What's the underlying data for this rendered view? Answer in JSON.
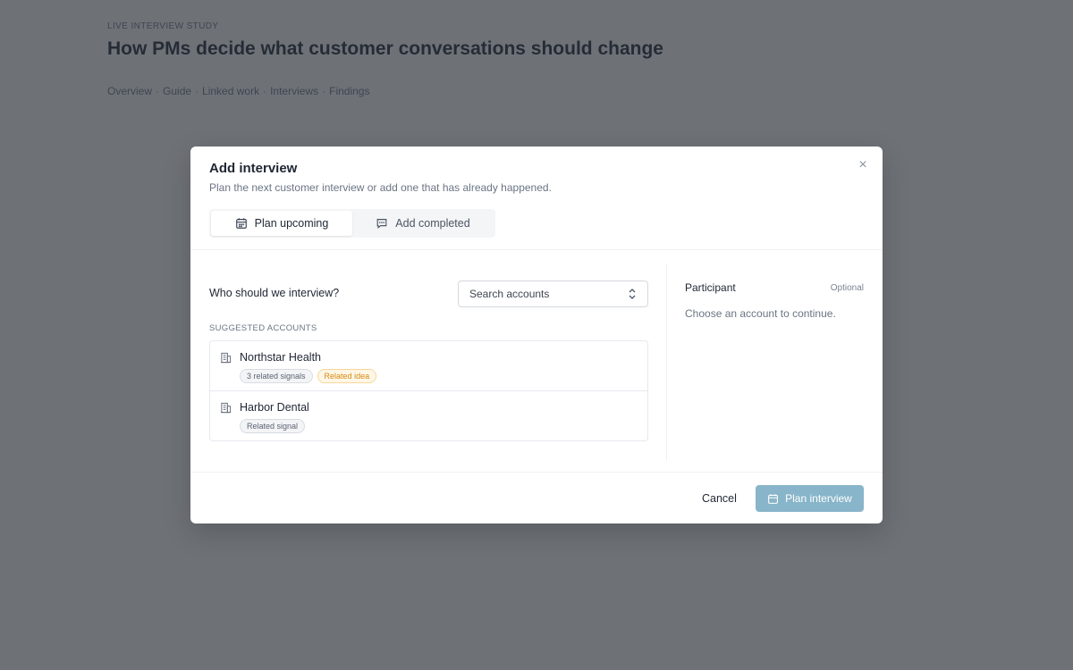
{
  "background": {
    "eyebrow": "LIVE INTERVIEW STUDY",
    "title": "How PMs decide what customer conversations should change",
    "nav": [
      "Overview",
      "Guide",
      "Linked work",
      "Interviews",
      "Findings"
    ],
    "nav_separator": "·"
  },
  "modal": {
    "title": "Add interview",
    "subtitle": "Plan the next customer interview or add one that has already happened.",
    "close_icon": "close-icon",
    "tabs": [
      {
        "label": "Plan upcoming",
        "icon": "calendar-icon",
        "active": true
      },
      {
        "label": "Add completed",
        "icon": "chat-icon",
        "active": false
      }
    ],
    "question": "Who should we interview?",
    "search": {
      "placeholder": "Search accounts",
      "icon": "chevron-up-down-icon"
    },
    "suggested_label": "SUGGESTED ACCOUNTS",
    "accounts": [
      {
        "name": "Northstar Health",
        "icon": "building-icon",
        "badges": [
          {
            "text": "3 related signals",
            "tone": "neutral"
          },
          {
            "text": "Related idea",
            "tone": "warning"
          }
        ]
      },
      {
        "name": "Harbor Dental",
        "icon": "building-icon",
        "badges": [
          {
            "text": "Related signal",
            "tone": "neutral"
          }
        ]
      }
    ],
    "participant": {
      "label": "Participant",
      "optional": "Optional",
      "hint": "Choose an account to continue."
    },
    "footer": {
      "cancel_label": "Cancel",
      "primary_label": "Plan interview",
      "primary_icon": "calendar-icon"
    }
  },
  "colors": {
    "overlay": "#6e7277",
    "primary_disabled": "#88b5c9",
    "warning_badge": "#d48a14"
  }
}
